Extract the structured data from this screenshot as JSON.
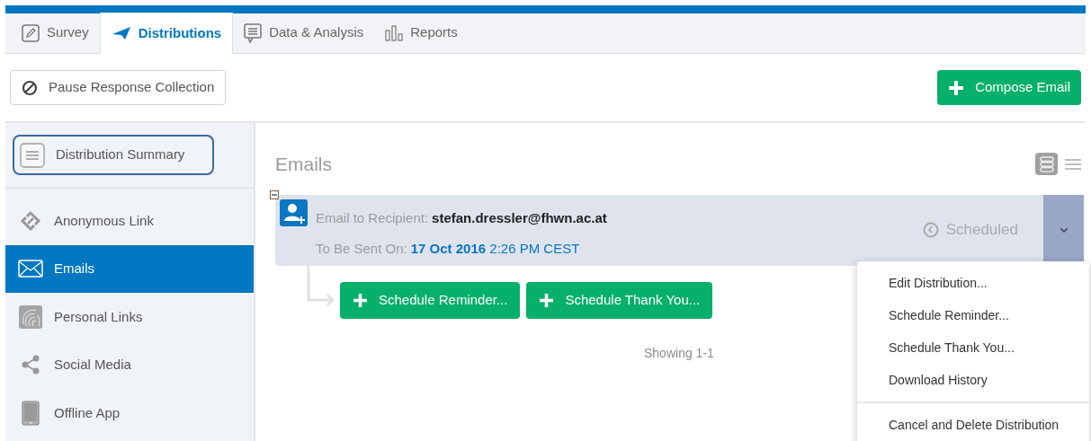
{
  "tabs": [
    {
      "label": "Survey",
      "selected": false
    },
    {
      "label": "Distributions",
      "selected": true
    },
    {
      "label": "Data & Analysis",
      "selected": false
    },
    {
      "label": "Reports",
      "selected": false
    }
  ],
  "toolbar": {
    "pause_button": "Pause Response Collection",
    "compose_button": "Compose Email"
  },
  "sidebar": {
    "summary": {
      "label": "Distribution Summary",
      "focused": true
    },
    "items": [
      {
        "label": "Anonymous Link",
        "selected": false
      },
      {
        "label": "Emails",
        "selected": true
      },
      {
        "label": "Personal Links",
        "selected": false
      },
      {
        "label": "Social Media",
        "selected": false
      },
      {
        "label": "Offline App",
        "selected": false
      }
    ]
  },
  "main": {
    "title": "Emails",
    "view_toggles": [
      {
        "kind": "cards",
        "selected": true
      },
      {
        "kind": "list",
        "selected": false
      }
    ],
    "distribution": {
      "expanded": true,
      "recipient_label": "Email to Recipient:",
      "recipient": "stefan.dressler@fhwn.ac.at",
      "send_label": "To Be Sent On:",
      "send_date": "**17 Oct 2016** 2:26 PM CEST",
      "status": "Scheduled"
    },
    "actions": [
      "Schedule Reminder...",
      "Schedule Thank You..."
    ],
    "showing": "Showing 1-1"
  },
  "menu": {
    "groups": [
      [
        "Edit Distribution...",
        "Schedule Reminder...",
        "Schedule Thank You...",
        "Download History"
      ],
      [
        "Cancel and Delete Distribution"
      ]
    ]
  }
}
